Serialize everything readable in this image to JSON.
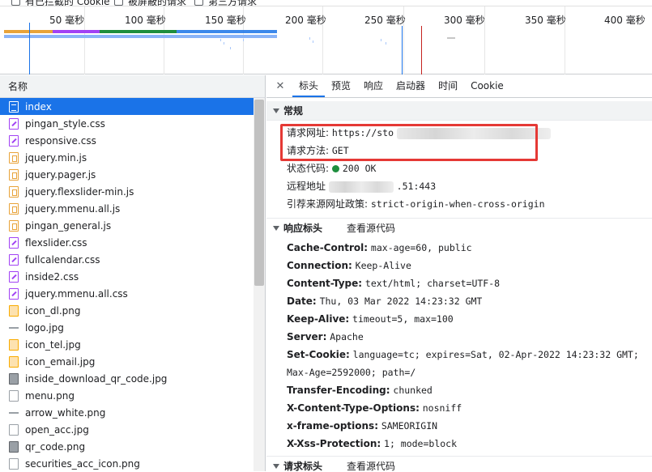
{
  "filterbar": {
    "items": [
      "有已拦截的 Cookie",
      "被屏蔽的请求",
      "第三方请求"
    ]
  },
  "timeline": {
    "ticks": [
      "50 毫秒",
      "100 毫秒",
      "150 毫秒",
      "200 毫秒",
      "250 毫秒",
      "300 毫秒",
      "350 毫秒",
      "400 毫秒"
    ]
  },
  "left": {
    "header": "名称",
    "requests": [
      {
        "name": "index",
        "icon": "document-icon",
        "type": "doc"
      },
      {
        "name": "pingan_style.css",
        "icon": "css-file-icon",
        "type": "css"
      },
      {
        "name": "responsive.css",
        "icon": "css-file-icon",
        "type": "css"
      },
      {
        "name": "jquery.min.js",
        "icon": "js-file-icon",
        "type": "js"
      },
      {
        "name": "jquery.pager.js",
        "icon": "js-file-icon",
        "type": "js"
      },
      {
        "name": "jquery.flexslider-min.js",
        "icon": "js-file-icon",
        "type": "js"
      },
      {
        "name": "jquery.mmenu.all.js",
        "icon": "js-file-icon",
        "type": "js"
      },
      {
        "name": "pingan_general.js",
        "icon": "js-file-icon",
        "type": "js"
      },
      {
        "name": "flexslider.css",
        "icon": "css-file-icon",
        "type": "css"
      },
      {
        "name": "fullcalendar.css",
        "icon": "css-file-icon",
        "type": "css"
      },
      {
        "name": "inside2.css",
        "icon": "css-file-icon",
        "type": "css"
      },
      {
        "name": "jquery.mmenu.all.css",
        "icon": "css-file-icon",
        "type": "css"
      },
      {
        "name": "icon_dl.png",
        "icon": "image-file-icon",
        "type": "img-orange"
      },
      {
        "name": "logo.jpg",
        "icon": "image-file-icon",
        "type": "img-line"
      },
      {
        "name": "icon_tel.jpg",
        "icon": "image-file-icon",
        "type": "img-orange"
      },
      {
        "name": "icon_email.jpg",
        "icon": "image-file-icon",
        "type": "img-orange"
      },
      {
        "name": "inside_download_qr_code.jpg",
        "icon": "image-file-icon",
        "type": "img-dark"
      },
      {
        "name": "menu.png",
        "icon": "image-file-icon",
        "type": "img"
      },
      {
        "name": "arrow_white.png",
        "icon": "image-file-icon",
        "type": "img-line"
      },
      {
        "name": "open_acc.jpg",
        "icon": "image-file-icon",
        "type": "img"
      },
      {
        "name": "qr_code.png",
        "icon": "image-file-icon",
        "type": "img-dark"
      },
      {
        "name": "securities_acc_icon.png",
        "icon": "image-file-icon",
        "type": "img"
      }
    ]
  },
  "tabs": {
    "close": "✕",
    "items": [
      "标头",
      "预览",
      "响应",
      "启动器",
      "时间",
      "Cookie"
    ],
    "active": "标头"
  },
  "general": {
    "title": "常规",
    "request_url_label": "请求网址:",
    "request_url_value": "https://sto",
    "request_method_label": "请求方法:",
    "request_method_value": "GET",
    "status_label": "状态代码:",
    "status_value": "200 OK",
    "remote_label": "远程地址",
    "remote_value": ".51:443",
    "referrer_label": "引荐来源网址政策:",
    "referrer_value": "strict-origin-when-cross-origin"
  },
  "response_headers": {
    "title": "响应标头",
    "view_source": "查看源代码",
    "items": [
      {
        "key": "Cache-Control:",
        "value": "max-age=60, public"
      },
      {
        "key": "Connection:",
        "value": "Keep-Alive"
      },
      {
        "key": "Content-Type:",
        "value": "text/html; charset=UTF-8"
      },
      {
        "key": "Date:",
        "value": "Thu, 03 Mar 2022 14:23:32 GMT"
      },
      {
        "key": "Keep-Alive:",
        "value": "timeout=5, max=100"
      },
      {
        "key": "Server:",
        "value": "Apache"
      },
      {
        "key": "Set-Cookie:",
        "value": "language=tc; expires=Sat, 02-Apr-2022 14:23:32 GMT; Max-Age=2592000; path=/"
      },
      {
        "key": "Transfer-Encoding:",
        "value": "chunked"
      },
      {
        "key": "X-Content-Type-Options:",
        "value": "nosniff"
      },
      {
        "key": "x-frame-options:",
        "value": "SAMEORIGIN"
      },
      {
        "key": "X-Xss-Protection:",
        "value": "1; mode=block"
      }
    ]
  },
  "request_headers": {
    "title": "请求标头",
    "view_source": "查看源代码"
  }
}
